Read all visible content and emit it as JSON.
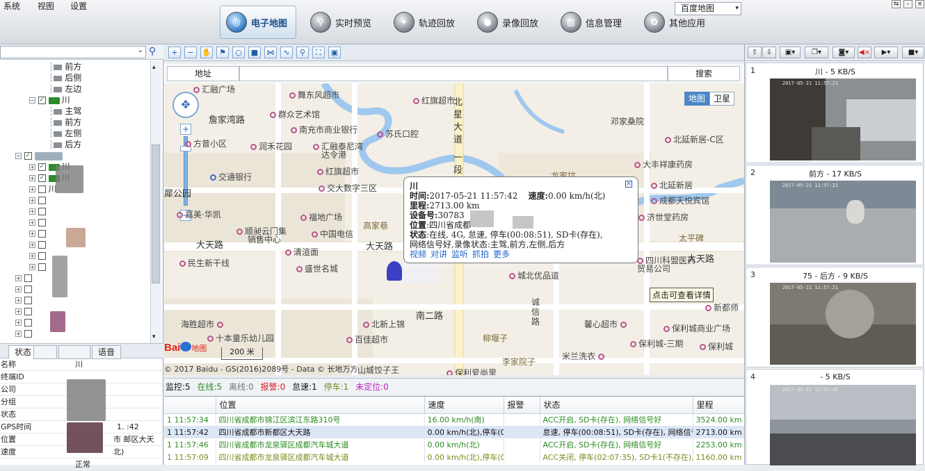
{
  "menu": [
    "系统",
    "视图",
    "设置"
  ],
  "nav": [
    {
      "label": "电子地图",
      "icon": "globe-icon",
      "active": true
    },
    {
      "label": "实时预览",
      "icon": "magnifier-icon",
      "active": false
    },
    {
      "label": "轨迹回放",
      "icon": "track-icon",
      "active": false
    },
    {
      "label": "录像回放",
      "icon": "film-icon",
      "active": false
    },
    {
      "label": "信息管理",
      "icon": "info-icon",
      "active": false
    },
    {
      "label": "其他应用",
      "icon": "apps-icon",
      "active": false
    }
  ],
  "tree": {
    "channels_a": [
      "前方",
      "后侧",
      "左边"
    ],
    "vehicle_b": "川",
    "channels_b": [
      "主驾",
      "前方",
      "左侧",
      "后方"
    ],
    "sub_vehicles": [
      "川",
      "川",
      "川"
    ]
  },
  "left_tabs": [
    "状态",
    "语音"
  ],
  "props": [
    {
      "k": "名称",
      "v": "川"
    },
    {
      "k": "终端ID",
      "v": ""
    },
    {
      "k": "公司",
      "v": ""
    },
    {
      "k": "分组",
      "v": ""
    },
    {
      "k": "状态",
      "v": ""
    },
    {
      "k": "GPS时间",
      "v": "1.    :42"
    },
    {
      "k": "位置",
      "v": "市  邮区大天"
    },
    {
      "k": "速度",
      "v": "北)"
    },
    {
      "k": "",
      "v": "正常"
    }
  ],
  "map_toolbar": {
    "map_type": "百度地图"
  },
  "address_bar": {
    "label": "地址",
    "search": "搜索"
  },
  "map": {
    "view_buttons": [
      "地图",
      "卫星"
    ],
    "scale": "200 米",
    "logo": "Bai",
    "logo2": "地图",
    "copyright": "© 2017 Baidu - GS(2016)2089号 - Data © 长地万方",
    "tooltip": "点击可查看详情",
    "labels": {
      "l1": "汇融广场",
      "l2": "舞东风超市",
      "l3": "红旗超市",
      "l4": "北",
      "l5": "星",
      "l6": "大",
      "l7": "道",
      "l8": "一",
      "l9": "段",
      "l10": "詹家湾路",
      "l11": "群众艺术馆",
      "l12": "南充市商业银行",
      "l13": "苏氏口腔",
      "l14": "邓家桑院",
      "l15": "方普小区",
      "l16": "润禾花园",
      "l17": "汇融泰尼湾",
      "l18": "达令港",
      "l19": "北延新居-C区",
      "l20": "交通银行",
      "l21": "红旗超市",
      "l22": "交大数字三区",
      "l23": "大丰祥康药房",
      "l24": "犀公园",
      "l25": "嘉美·华凯",
      "l26": "福地广场",
      "l27": "北延新居",
      "l28": "成都天悦宾馆",
      "l29": "顺昶云门集",
      "l30": "销售中心",
      "l31": "中国电信",
      "l32": "高家巷",
      "l33": "济世堂药房",
      "l34": "大天路",
      "l35": "清渲面",
      "l36": "大天路",
      "l37": "太平碑",
      "l38": "民生新干线",
      "l39": "盛世名城",
      "l40": "城北优品道",
      "l41": "四川科盟医药",
      "l42": "贸易公司",
      "l43": "大天路",
      "l44": "诚",
      "l45": "信",
      "l46": "路",
      "l47": "南二路",
      "l48": "新都师",
      "l49": "海胜超市",
      "l50": "北新上锦",
      "l51": "馨心超市",
      "l52": "保利城商业广场",
      "l53": "十本童乐幼儿园",
      "l54": "百佳超市",
      "l55": "柳堰子",
      "l56": "保利城-三期",
      "l57": "保利城",
      "l58": "李家院子",
      "l59": "米兰洗衣",
      "l60": "山城饺子王",
      "l61": "保利爱尚里",
      "l62": "龙家坟"
    }
  },
  "popup": {
    "plate": "川",
    "time_k": "时间:",
    "time_v": "2017-05-21 11:57:42",
    "speed_k": "速度:",
    "speed_v": "0.00 km/h(北)",
    "mileage_k": "里程:",
    "mileage_v": "2713.00 km",
    "device_k": "设备号:",
    "device_v": "30783",
    "pos_k": "位置",
    "pos_v": ":四川省成都",
    "status_k": "状态",
    "status_v": ":在线, 4G, 怠速, 停车(00:08:51), SD卡(存在),",
    "status_v2": "网络信号好,录像状态:主驾,前方,左侧,后方",
    "links": [
      "视频",
      "对讲",
      "监听",
      "抓拍",
      "更多"
    ]
  },
  "statusline": [
    {
      "label": "监控:5",
      "color": "#111"
    },
    {
      "label": "在线:5",
      "color": "#2c8a22"
    },
    {
      "label": "离线:0",
      "color": "#777"
    },
    {
      "label": "报警:0",
      "color": "#d02020"
    },
    {
      "label": "怠速:1",
      "color": "#111"
    },
    {
      "label": "停车:1",
      "color": "#7a8a1a"
    },
    {
      "label": "未定位:0",
      "color": "#c020c0"
    }
  ],
  "table": {
    "headers": [
      "",
      "位置",
      "速度",
      "报警",
      "状态",
      "里程"
    ],
    "rows": [
      [
        "1 11:57:34",
        "四川省成都市锦江区滨江东路310号",
        "16.00 km/h(南)",
        "",
        "ACC开启, SD卡(存在), 网络信号好",
        "3524.00 km"
      ],
      [
        "1 11:57:42",
        "四川省成都市新都区大天路",
        "0.00 km/h(北),停车(0",
        "",
        "怠速, 停车(00:08:51), SD卡(存在), 网络信号",
        "2713.00 km"
      ],
      [
        "1 11:57:46",
        "四川省成都市龙泉驿区成都汽车城大道",
        "0.00 km/h(北)",
        "",
        "ACC开启, SD卡(存在), 网络信号好",
        "2253.00 km"
      ],
      [
        "1 11:57:09",
        "四川省成都市龙泉驿区成都汽车城大道",
        "0.00 km/h(北),停车(0",
        "",
        "ACC关闭, 停车(02:07:35), SD卡1(不存在),S",
        "1160.00 km"
      ]
    ]
  },
  "video": [
    {
      "num": "1",
      "title": "川      - 5 KB/S",
      "stamp": "2017-05-21 11:57:21",
      "tone": "#8c8f92"
    },
    {
      "num": "2",
      "title": "前方 - 17 KB/S",
      "stamp": "2017-05-21 11:57:21",
      "tone": "#9aa0a6"
    },
    {
      "num": "3",
      "title": "75 - 后方 - 9 KB/S",
      "stamp": "2017-05-21 11:57:21",
      "tone": "#7d7a73"
    },
    {
      "num": "4",
      "title": "- 5 KB/S",
      "stamp": "2017-05-21 11:57:45",
      "tone": "#8d949b"
    }
  ]
}
